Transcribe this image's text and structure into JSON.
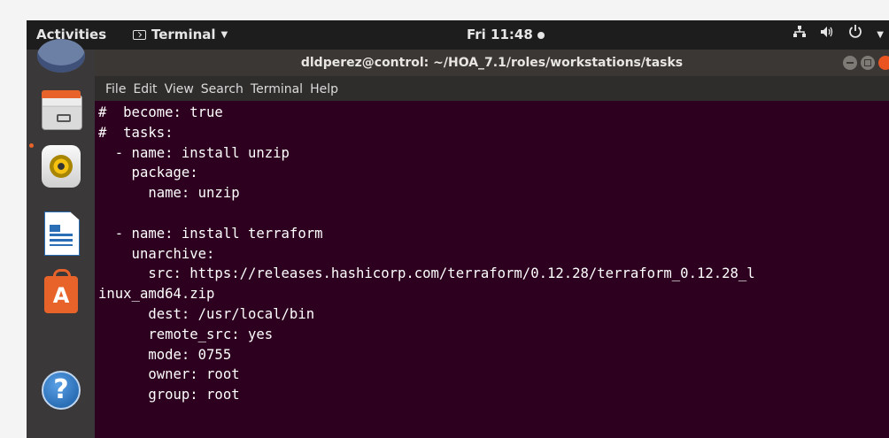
{
  "topbar": {
    "activities": "Activities",
    "app_menu": "Terminal",
    "clock": "Fri 11:48"
  },
  "window": {
    "title": "dldperez@control: ~/HOA_7.1/roles/workstations/tasks"
  },
  "menubar": {
    "items": [
      "File",
      "Edit",
      "View",
      "Search",
      "Terminal",
      "Help"
    ]
  },
  "terminal": {
    "lines": [
      "#  become: true",
      "#  tasks:",
      "  - name: install unzip",
      "    package:",
      "      name: unzip",
      "",
      "  - name: install terraform",
      "    unarchive:",
      "      src: https://releases.hashicorp.com/terraform/0.12.28/terraform_0.12.28_l",
      "inux_amd64.zip",
      "      dest: /usr/local/bin",
      "      remote_src: yes",
      "      mode: 0755",
      "      owner: root",
      "      group: root"
    ]
  },
  "dock": {
    "icons": [
      "thunderbird-icon",
      "files-icon",
      "rhythmbox-icon",
      "libreoffice-writer-icon",
      "ubuntu-software-icon",
      "help-icon"
    ]
  }
}
